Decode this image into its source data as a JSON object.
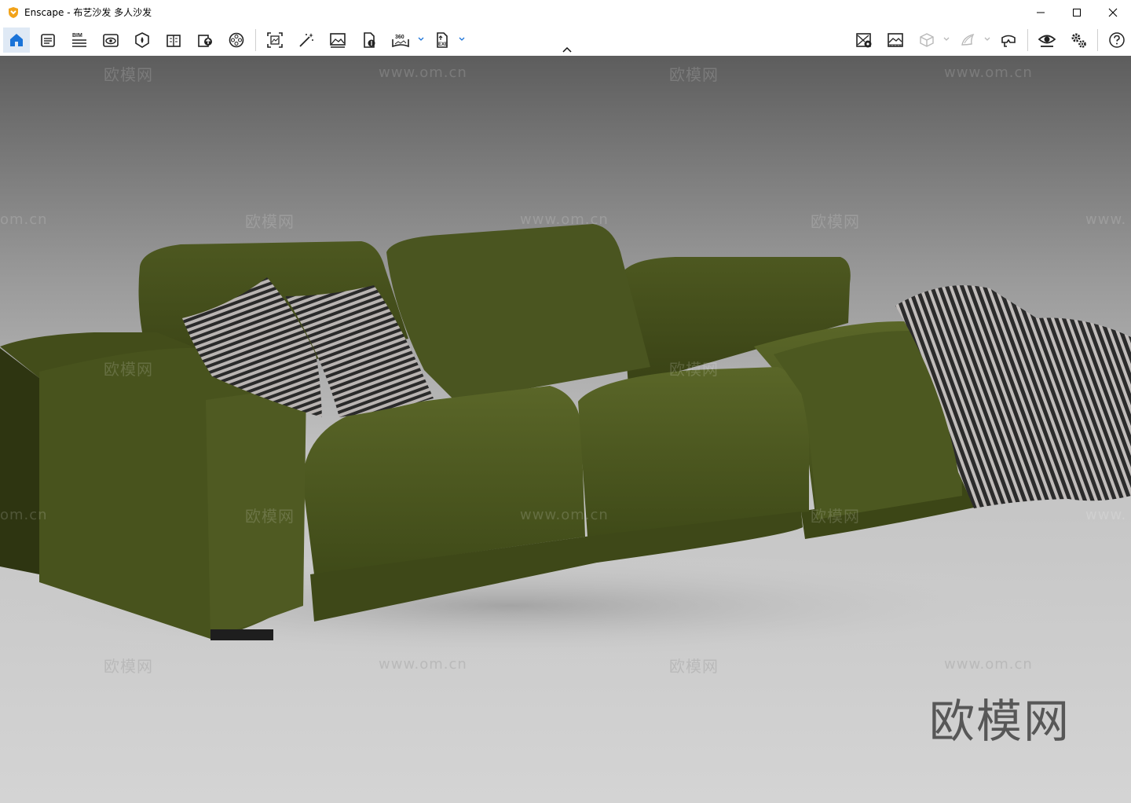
{
  "window": {
    "app_name": "Enscape",
    "title": "Enscape - 布艺沙发 多人沙发"
  },
  "toolbar": {
    "left_buttons": [
      {
        "icon": "home-icon",
        "active": true
      },
      {
        "icon": "views-icon"
      },
      {
        "icon": "bim-icon",
        "label": "BIM"
      },
      {
        "icon": "visual-settings-icon"
      },
      {
        "icon": "asset-library-icon"
      },
      {
        "icon": "material-editor-icon"
      },
      {
        "icon": "upload-manager-icon"
      },
      {
        "icon": "video-editor-icon"
      },
      {
        "icon": "screenshot-icon"
      },
      {
        "icon": "batch-render-icon"
      },
      {
        "icon": "render-image-icon"
      },
      {
        "icon": "web-standalone-icon"
      },
      {
        "icon": "panorama-icon",
        "label": "360"
      },
      {
        "icon": "export-exe-icon",
        "label": "EXE"
      }
    ],
    "right_buttons": [
      {
        "icon": "sync-view-icon"
      },
      {
        "icon": "capture-view-icon"
      },
      {
        "icon": "orthographic-view-icon"
      },
      {
        "icon": "section-planes-icon"
      },
      {
        "icon": "vr-headset-icon"
      },
      {
        "icon": "eye-icon"
      },
      {
        "icon": "settings-icon"
      },
      {
        "icon": "help-icon"
      }
    ]
  },
  "viewport": {
    "watermark_cn": "欧模网",
    "watermark_url": "www.om.cn",
    "watermark_url_partial": "om.cn",
    "watermark_url_partial_right": "www.",
    "big_watermark": "欧模网"
  },
  "colors": {
    "accent": "#1a73d8",
    "sofa": "#4e5a22",
    "background_top": "#5d5d5d",
    "background_bottom": "#d2d2d2"
  }
}
